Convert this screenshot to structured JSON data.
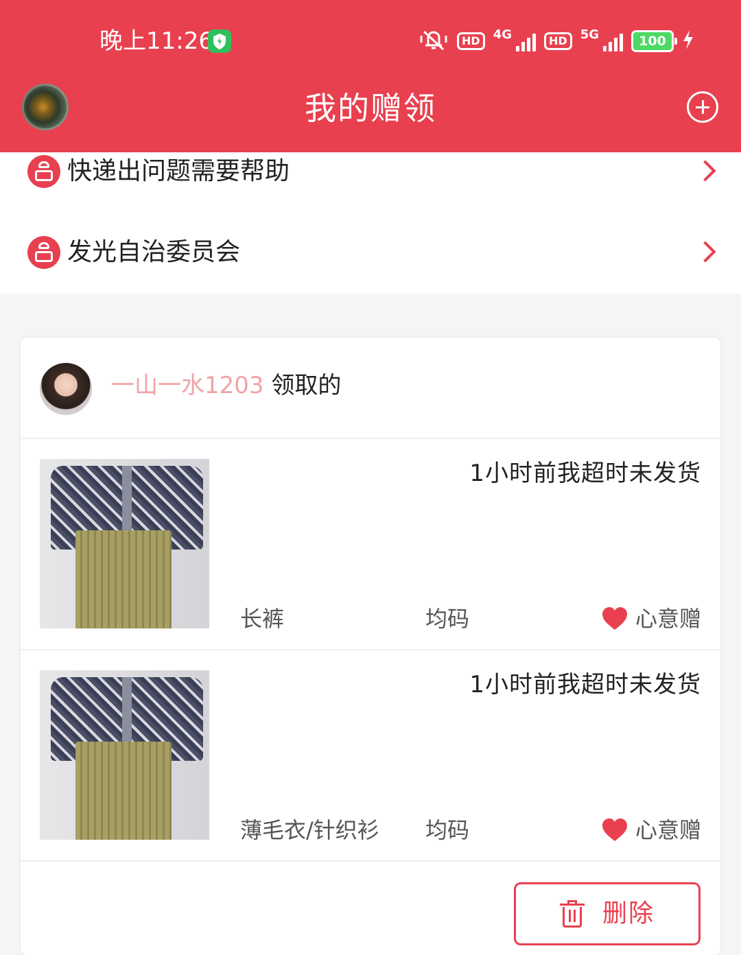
{
  "status_bar": {
    "time": "晚上11:26",
    "hd1": "HD",
    "net1": "4G",
    "hd2": "HD",
    "net2": "5G",
    "battery": "100"
  },
  "header": {
    "title": "我的赠领"
  },
  "menu": {
    "items": [
      {
        "label": "快递出问题需要帮助"
      },
      {
        "label": "发光自治委员会"
      }
    ]
  },
  "card": {
    "receiver": "一山一水1203",
    "received_suffix": "领取的",
    "items": [
      {
        "status": "1小时前我超时未发货",
        "name": "长裤",
        "size": "均码",
        "type": "心意赠"
      },
      {
        "status": "1小时前我超时未发货",
        "name": "薄毛衣/针织衫",
        "size": "均码",
        "type": "心意赠"
      }
    ],
    "delete_label": "删除"
  },
  "colors": {
    "brand": "#e8404f",
    "receiver_name": "#f0a3a6"
  }
}
